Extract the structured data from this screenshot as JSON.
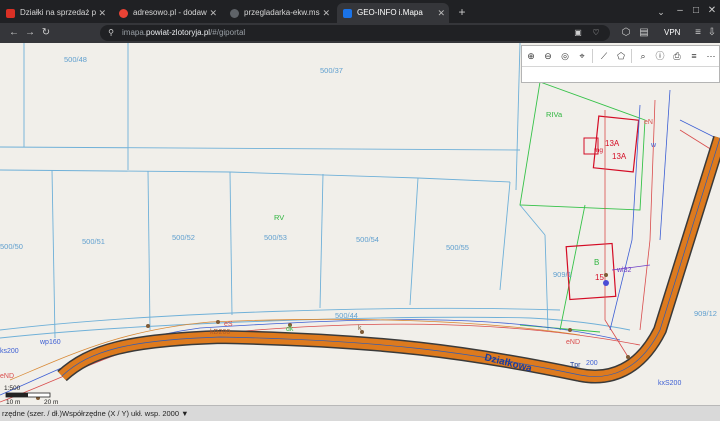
{
  "browser": {
    "tabs": [
      {
        "title": "Działki na sprzedaż powiat złot",
        "active": false,
        "favicon_color": "#d93025"
      },
      {
        "title": "adresowo.pl - dodawanie bezpł",
        "active": false,
        "favicon_color": "#ea4335"
      },
      {
        "title": "przegladarka-ekw.ms.gov.pl/eu",
        "active": false,
        "favicon_color": "#5f6368"
      },
      {
        "title": "GEO-INFO i.Mapa",
        "active": true,
        "favicon_color": "#1a73e8"
      }
    ],
    "url_prefix": "imapa.",
    "url_domain": "powiat-zlotoryja.pl",
    "url_suffix": "/#/giportal",
    "vpn_label": "VPN"
  },
  "map": {
    "parcels": [
      "500/48",
      "500/37",
      "500/50",
      "500/51",
      "500/52",
      "500/53",
      "500/54",
      "500/55",
      "500/44",
      "909/1",
      "909/12"
    ],
    "landuse_labels": [
      "RV",
      "RIVa"
    ],
    "buildings": [
      {
        "number": "13A",
        "label": "13A",
        "code": "mg"
      },
      {
        "number": "15",
        "label": "B"
      }
    ],
    "street_name": "Działkowa",
    "street_suffix": "Tpr",
    "utility_labels": [
      "eN",
      "eS",
      "wp160",
      "ks200",
      "kxD200",
      "kD200",
      "eND",
      "wl32",
      "w",
      "dk",
      "k",
      "kD200",
      "w900",
      "kS200",
      "kxS200",
      "kd200",
      "w0",
      "w160",
      "eD",
      "eND",
      "200"
    ],
    "scale": {
      "ratio": "1:500",
      "label_left": "10 m",
      "label_right": "20 m"
    }
  },
  "statusbar": {
    "coords_label": "rzędne (szer. / dł.)",
    "system_label": "Współrzędne (X / Y) ukł. wsp. 2000 ▼"
  }
}
